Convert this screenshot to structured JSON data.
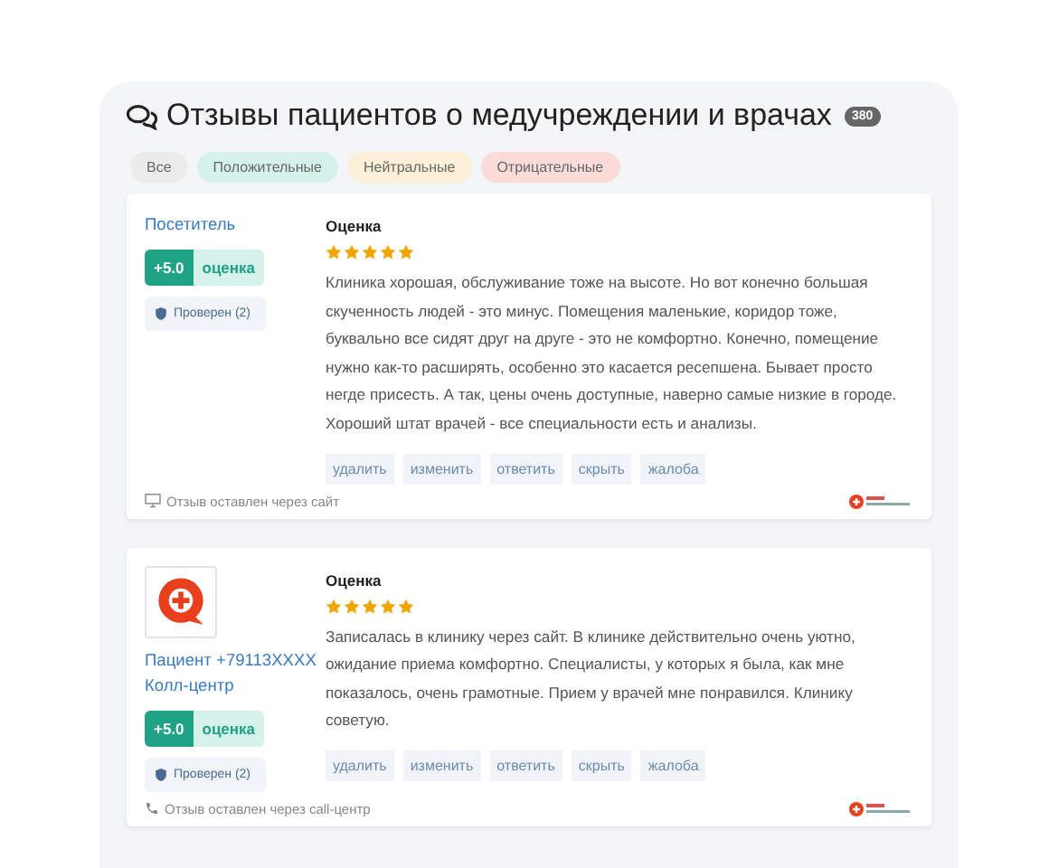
{
  "title": "Отзывы пациентов о медучреждении и врачах",
  "count": "380",
  "filters": [
    {
      "label": "Все",
      "kind": "all"
    },
    {
      "label": "Положительные",
      "kind": "positive"
    },
    {
      "label": "Нейтральные",
      "kind": "neutral"
    },
    {
      "label": "Отрицательные",
      "kind": "negative"
    }
  ],
  "reviews": [
    {
      "author": [
        "Посетитель"
      ],
      "has_avatar": false,
      "score": "+5.0",
      "score_label": "оценка",
      "verified": "Проверен (2)",
      "rating_title": "Оценка",
      "stars": 5,
      "text": "Клиника хорошая, обслуживание тоже на высоте. Но вот конечно большая скученность людей - это минус. Помещения маленькие, коридор тоже, буквально все сидят друг на друге - это не комфортно. Конечно, помещение нужно как-то расширять, особенно это касается ресепшена. Бывает просто негде присесть. А так, цены очень доступные, наверно самые низкие в городе. Хороший штат врачей - все специальности есть и анализы.",
      "actions": [
        "удалить",
        "изменить",
        "ответить",
        "скрыть",
        "жалоба"
      ],
      "source": {
        "kind": "site",
        "text": "Отзыв оставлен через сайт"
      }
    },
    {
      "author": [
        "Пациент +79113XXXX",
        "Колл-центр"
      ],
      "has_avatar": true,
      "score": "+5.0",
      "score_label": "оценка",
      "verified": "Проверен (2)",
      "rating_title": "Оценка",
      "stars": 5,
      "text": "Записалась в клинику через сайт. В клинике действительно очень уютно, ожидание приема комфортно. Специалисты, у которых я была, как мне показалось, очень грамотные. Прием у врачей мне понравился. Клинику советую.",
      "actions": [
        "удалить",
        "изменить",
        "ответить",
        "скрыть",
        "жалоба"
      ],
      "source": {
        "kind": "call",
        "text": "Отзыв оставлен через call-центр"
      }
    }
  ]
}
